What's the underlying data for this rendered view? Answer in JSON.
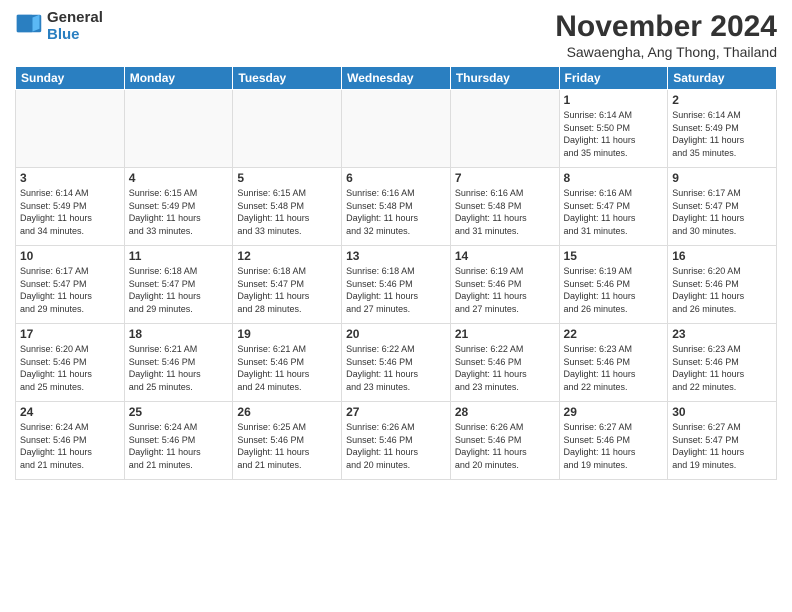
{
  "logo": {
    "general": "General",
    "blue": "Blue"
  },
  "title": "November 2024",
  "subtitle": "Sawaengha, Ang Thong, Thailand",
  "headers": [
    "Sunday",
    "Monday",
    "Tuesday",
    "Wednesday",
    "Thursday",
    "Friday",
    "Saturday"
  ],
  "weeks": [
    [
      {
        "day": "",
        "info": ""
      },
      {
        "day": "",
        "info": ""
      },
      {
        "day": "",
        "info": ""
      },
      {
        "day": "",
        "info": ""
      },
      {
        "day": "",
        "info": ""
      },
      {
        "day": "1",
        "info": "Sunrise: 6:14 AM\nSunset: 5:50 PM\nDaylight: 11 hours\nand 35 minutes."
      },
      {
        "day": "2",
        "info": "Sunrise: 6:14 AM\nSunset: 5:49 PM\nDaylight: 11 hours\nand 35 minutes."
      }
    ],
    [
      {
        "day": "3",
        "info": "Sunrise: 6:14 AM\nSunset: 5:49 PM\nDaylight: 11 hours\nand 34 minutes."
      },
      {
        "day": "4",
        "info": "Sunrise: 6:15 AM\nSunset: 5:49 PM\nDaylight: 11 hours\nand 33 minutes."
      },
      {
        "day": "5",
        "info": "Sunrise: 6:15 AM\nSunset: 5:48 PM\nDaylight: 11 hours\nand 33 minutes."
      },
      {
        "day": "6",
        "info": "Sunrise: 6:16 AM\nSunset: 5:48 PM\nDaylight: 11 hours\nand 32 minutes."
      },
      {
        "day": "7",
        "info": "Sunrise: 6:16 AM\nSunset: 5:48 PM\nDaylight: 11 hours\nand 31 minutes."
      },
      {
        "day": "8",
        "info": "Sunrise: 6:16 AM\nSunset: 5:47 PM\nDaylight: 11 hours\nand 31 minutes."
      },
      {
        "day": "9",
        "info": "Sunrise: 6:17 AM\nSunset: 5:47 PM\nDaylight: 11 hours\nand 30 minutes."
      }
    ],
    [
      {
        "day": "10",
        "info": "Sunrise: 6:17 AM\nSunset: 5:47 PM\nDaylight: 11 hours\nand 29 minutes."
      },
      {
        "day": "11",
        "info": "Sunrise: 6:18 AM\nSunset: 5:47 PM\nDaylight: 11 hours\nand 29 minutes."
      },
      {
        "day": "12",
        "info": "Sunrise: 6:18 AM\nSunset: 5:47 PM\nDaylight: 11 hours\nand 28 minutes."
      },
      {
        "day": "13",
        "info": "Sunrise: 6:18 AM\nSunset: 5:46 PM\nDaylight: 11 hours\nand 27 minutes."
      },
      {
        "day": "14",
        "info": "Sunrise: 6:19 AM\nSunset: 5:46 PM\nDaylight: 11 hours\nand 27 minutes."
      },
      {
        "day": "15",
        "info": "Sunrise: 6:19 AM\nSunset: 5:46 PM\nDaylight: 11 hours\nand 26 minutes."
      },
      {
        "day": "16",
        "info": "Sunrise: 6:20 AM\nSunset: 5:46 PM\nDaylight: 11 hours\nand 26 minutes."
      }
    ],
    [
      {
        "day": "17",
        "info": "Sunrise: 6:20 AM\nSunset: 5:46 PM\nDaylight: 11 hours\nand 25 minutes."
      },
      {
        "day": "18",
        "info": "Sunrise: 6:21 AM\nSunset: 5:46 PM\nDaylight: 11 hours\nand 25 minutes."
      },
      {
        "day": "19",
        "info": "Sunrise: 6:21 AM\nSunset: 5:46 PM\nDaylight: 11 hours\nand 24 minutes."
      },
      {
        "day": "20",
        "info": "Sunrise: 6:22 AM\nSunset: 5:46 PM\nDaylight: 11 hours\nand 23 minutes."
      },
      {
        "day": "21",
        "info": "Sunrise: 6:22 AM\nSunset: 5:46 PM\nDaylight: 11 hours\nand 23 minutes."
      },
      {
        "day": "22",
        "info": "Sunrise: 6:23 AM\nSunset: 5:46 PM\nDaylight: 11 hours\nand 22 minutes."
      },
      {
        "day": "23",
        "info": "Sunrise: 6:23 AM\nSunset: 5:46 PM\nDaylight: 11 hours\nand 22 minutes."
      }
    ],
    [
      {
        "day": "24",
        "info": "Sunrise: 6:24 AM\nSunset: 5:46 PM\nDaylight: 11 hours\nand 21 minutes."
      },
      {
        "day": "25",
        "info": "Sunrise: 6:24 AM\nSunset: 5:46 PM\nDaylight: 11 hours\nand 21 minutes."
      },
      {
        "day": "26",
        "info": "Sunrise: 6:25 AM\nSunset: 5:46 PM\nDaylight: 11 hours\nand 21 minutes."
      },
      {
        "day": "27",
        "info": "Sunrise: 6:26 AM\nSunset: 5:46 PM\nDaylight: 11 hours\nand 20 minutes."
      },
      {
        "day": "28",
        "info": "Sunrise: 6:26 AM\nSunset: 5:46 PM\nDaylight: 11 hours\nand 20 minutes."
      },
      {
        "day": "29",
        "info": "Sunrise: 6:27 AM\nSunset: 5:46 PM\nDaylight: 11 hours\nand 19 minutes."
      },
      {
        "day": "30",
        "info": "Sunrise: 6:27 AM\nSunset: 5:47 PM\nDaylight: 11 hours\nand 19 minutes."
      }
    ]
  ]
}
